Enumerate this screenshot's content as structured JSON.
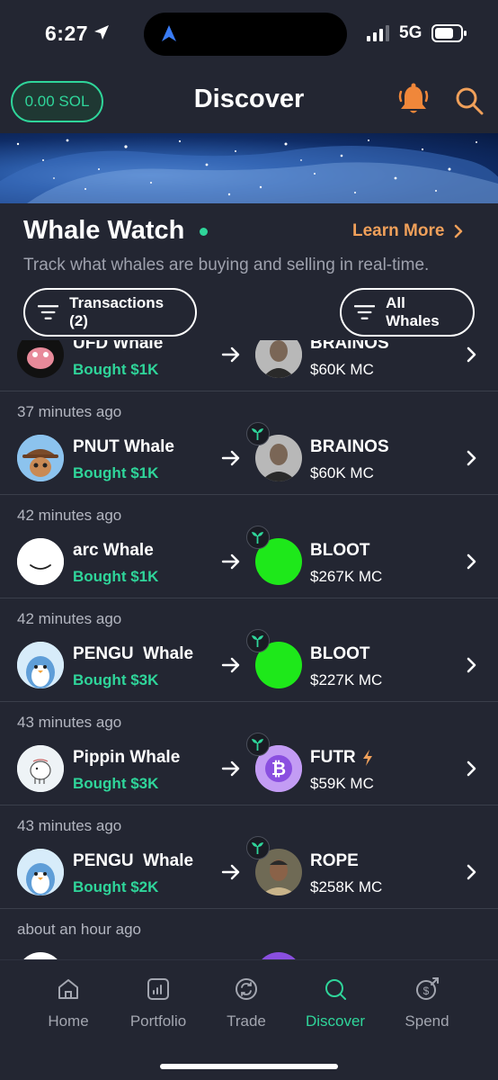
{
  "status_bar": {
    "time": "6:27",
    "network": "5G"
  },
  "header": {
    "balance": "0.00 SOL",
    "title": "Discover",
    "icons": [
      "bell-icon",
      "search-icon"
    ]
  },
  "section": {
    "title": "Whale Watch",
    "learn_more": "Learn More",
    "subtitle": "Track what whales are buying and selling in real-time.",
    "filter_transactions": "Transactions (2)",
    "filter_whales": "All Whales"
  },
  "transactions": [
    {
      "time": "",
      "whale": "UFD Whale",
      "action": "Bought $1K",
      "token": "BRAINOS",
      "market_cap": "$60K MC",
      "boosted": false
    },
    {
      "time": "37 minutes ago",
      "whale": "PNUT Whale",
      "action": "Bought $1K",
      "token": "BRAINOS",
      "market_cap": "$60K MC",
      "boosted": false
    },
    {
      "time": "42 minutes ago",
      "whale": "arc Whale",
      "action": "Bought $1K",
      "token": "BLOOT",
      "market_cap": "$267K MC",
      "boosted": false
    },
    {
      "time": "42 minutes ago",
      "whale": "PENGU  Whale",
      "action": "Bought $3K",
      "token": "BLOOT",
      "market_cap": "$227K MC",
      "boosted": false
    },
    {
      "time": "43 minutes ago",
      "whale": "Pippin Whale",
      "action": "Bought $3K",
      "token": "FUTR",
      "market_cap": "$59K MC",
      "boosted": true
    },
    {
      "time": "43 minutes ago",
      "whale": "PENGU  Whale",
      "action": "Bought $2K",
      "token": "ROPE",
      "market_cap": "$258K MC",
      "boosted": false
    },
    {
      "time": "about an hour ago",
      "whale": "",
      "action": "",
      "token": "",
      "market_cap": "",
      "boosted": false
    }
  ],
  "tabs": [
    {
      "label": "Home",
      "icon": "home-icon",
      "active": false
    },
    {
      "label": "Portfolio",
      "icon": "portfolio-icon",
      "active": false
    },
    {
      "label": "Trade",
      "icon": "trade-icon",
      "active": false
    },
    {
      "label": "Discover",
      "icon": "discover-icon",
      "active": true
    },
    {
      "label": "Spend",
      "icon": "spend-icon",
      "active": false
    }
  ],
  "colors": {
    "background": "#232632",
    "accent_green": "#2fd59a",
    "accent_orange": "#f0a05a",
    "divider": "#3a3e4a"
  }
}
